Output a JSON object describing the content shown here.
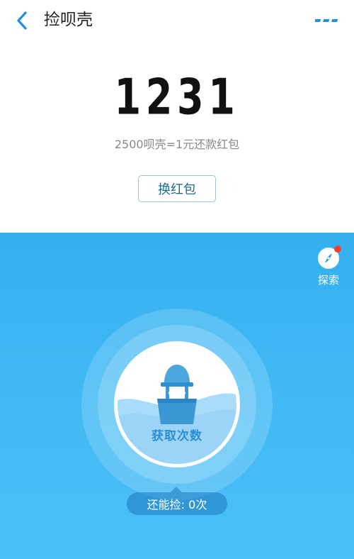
{
  "header": {
    "title": "捡呗壳",
    "back_icon": "chevron-left-icon",
    "more_icon": "more-dots-icon",
    "accent_color": "#1e90e0"
  },
  "balance": {
    "value": "1231",
    "rate_text": "2500呗壳=1元还款红包",
    "redeem_label": "换红包"
  },
  "explore": {
    "label": "探索",
    "icon": "compass-icon",
    "has_notification": true,
    "notification_color": "#ff3b30"
  },
  "pick": {
    "button_label": "获取次数",
    "icon": "basket-icon",
    "remaining_text": "还能捡: 0次"
  },
  "colors": {
    "blue_area": "#3fb6f4",
    "label_blue": "#2a8fd2",
    "button_text": "#1c6e8c"
  }
}
